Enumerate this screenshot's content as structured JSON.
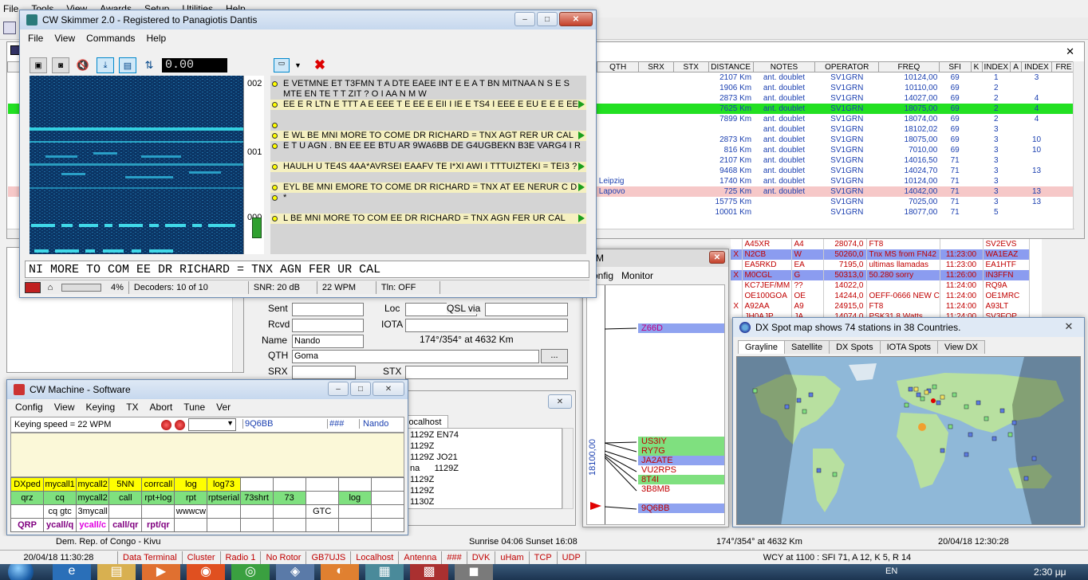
{
  "main_menu": [
    "File",
    "Tools",
    "View",
    "Awards",
    "Setup",
    "Utilities",
    "Help"
  ],
  "log": {
    "headers": [
      "QTH",
      "SRX",
      "STX",
      "DISTANCE",
      "NOTES",
      "OPERATOR",
      "FREQ",
      "SFI",
      "K",
      "INDEX",
      "A",
      "INDEX",
      "FRE"
    ],
    "rows": [
      {
        "qth": "",
        "distance": "2107 Km",
        "notes": "ant. doublet",
        "operator": "SV1GRN",
        "freq": "10124,00",
        "sfi": "69",
        "k": "1",
        "a": "3",
        "bg": ""
      },
      {
        "qth": "",
        "distance": "1906 Km",
        "notes": "ant. doublet",
        "operator": "SV1GRN",
        "freq": "10110,00",
        "sfi": "69",
        "k": "2",
        "a": "",
        "bg": ""
      },
      {
        "qth": "",
        "distance": "2873 Km",
        "notes": "ant. doublet",
        "operator": "SV1GRN",
        "freq": "14027,00",
        "sfi": "69",
        "k": "2",
        "a": "4",
        "bg": ""
      },
      {
        "qth": "",
        "distance": "7625 Km",
        "notes": "ant. doublet",
        "operator": "SV1GRN",
        "freq": "18075,00",
        "sfi": "69",
        "k": "2",
        "a": "4",
        "bg": "#22e022"
      },
      {
        "qth": "",
        "distance": "7899 Km",
        "notes": "ant. doublet",
        "operator": "SV1GRN",
        "freq": "18074,00",
        "sfi": "69",
        "k": "2",
        "a": "4",
        "bg": ""
      },
      {
        "qth": "",
        "distance": "",
        "notes": "ant. doublet",
        "operator": "SV1GRN",
        "freq": "18102,02",
        "sfi": "69",
        "k": "3",
        "a": "",
        "bg": ""
      },
      {
        "qth": "",
        "distance": "2873 Km",
        "notes": "ant. doublet",
        "operator": "SV1GRN",
        "freq": "18075,00",
        "sfi": "69",
        "k": "3",
        "a": "10",
        "bg": ""
      },
      {
        "qth": "",
        "distance": "816 Km",
        "notes": "ant. doublet",
        "operator": "SV1GRN",
        "freq": "7010,00",
        "sfi": "69",
        "k": "3",
        "a": "10",
        "bg": ""
      },
      {
        "qth": "",
        "distance": "2107 Km",
        "notes": "ant. doublet",
        "operator": "SV1GRN",
        "freq": "14016,50",
        "sfi": "71",
        "k": "3",
        "a": "",
        "bg": ""
      },
      {
        "qth": "",
        "distance": "9468 Km",
        "notes": "ant. doublet",
        "operator": "SV1GRN",
        "freq": "14024,70",
        "sfi": "71",
        "k": "3",
        "a": "13",
        "bg": ""
      },
      {
        "qth": "Leipzig",
        "distance": "1740 Km",
        "notes": "ant. doublet",
        "operator": "SV1GRN",
        "freq": "10124,00",
        "sfi": "71",
        "k": "3",
        "a": "",
        "bg": ""
      },
      {
        "qth": "Lapovo",
        "distance": "725 Km",
        "notes": "ant. doublet",
        "operator": "SV1GRN",
        "freq": "14042,00",
        "sfi": "71",
        "k": "3",
        "a": "13",
        "bg": "#f6c8c8"
      },
      {
        "qth": "",
        "distance": "15775 Km",
        "notes": "",
        "operator": "SV1GRN",
        "freq": "7025,00",
        "sfi": "71",
        "k": "3",
        "a": "13",
        "bg": ""
      },
      {
        "qth": "",
        "distance": "10001 Km",
        "notes": "",
        "operator": "SV1GRN",
        "freq": "18077,00",
        "sfi": "71",
        "k": "5",
        "a": "",
        "bg": ""
      }
    ]
  },
  "spots": [
    {
      "x": "",
      "call": "A45XR",
      "pfx": "A4",
      "freq": "28074,0",
      "comment": "FT8",
      "time": "",
      "spotter": "SV2EVS",
      "bg": "#fff"
    },
    {
      "x": "X",
      "call": "N2CB",
      "pfx": "W",
      "freq": "50260,0",
      "comment": "Tnx MS from FN42",
      "time": "11:23:00",
      "spotter": "WA1EAZ",
      "bg": "#8b9cf0"
    },
    {
      "x": "",
      "call": "EA5RKD",
      "pfx": "EA",
      "freq": "7195,0",
      "comment": "ultimas llamadas",
      "time": "11:23:00",
      "spotter": "EA1HTF",
      "bg": "#fff"
    },
    {
      "x": "X",
      "call": "M0CGL",
      "pfx": "G",
      "freq": "50313,0",
      "comment": "50.280 sorry",
      "time": "11:26:00",
      "spotter": "IN3FFN",
      "bg": "#8b9cf0"
    },
    {
      "x": "",
      "call": "KC7JEF/MM",
      "pfx": "??",
      "freq": "14022,0",
      "comment": "",
      "time": "11:24:00",
      "spotter": "RQ9A",
      "bg": "#fff"
    },
    {
      "x": "",
      "call": "OE100GOA",
      "pfx": "OE",
      "freq": "14244,0",
      "comment": "OEFF-0666 NEW C",
      "time": "11:24:00",
      "spotter": "OE1MRC",
      "bg": "#fff"
    },
    {
      "x": "X",
      "call": "A92AA",
      "pfx": "A9",
      "freq": "24915,0",
      "comment": "FT8",
      "time": "11:24:00",
      "spotter": "A93LT",
      "bg": "#fff"
    },
    {
      "x": "",
      "call": "JH0AJP",
      "pfx": "JA",
      "freq": "14074,0",
      "comment": "PSK31 8 Watts",
      "time": "11:24:00",
      "spotter": "SV3FOP",
      "bg": "#fff"
    }
  ],
  "skimmer": {
    "title": "CW Skimmer 2.0 - Registered to Panagiotis Dantis",
    "menu": [
      "File",
      "View",
      "Commands",
      "Help"
    ],
    "level": "0.00",
    "scale": [
      "002",
      "001",
      "000"
    ],
    "lines": [
      {
        "text": "E VETMNE ET T3FMN T A DTE EAEE INT E E A T BN MITNAA N S E S",
        "bg": "#d4d4d4",
        "marker": true
      },
      {
        "text": "MTE EN TE T T ZIT ? O I AA N M W",
        "bg": "#d4d4d4",
        "marker": false
      },
      {
        "text": "EE E R LTN E TTT A E EEE T E EE E EII I IE E TS4 I EEE E EU E E E EE",
        "bg": "#f5f0c0",
        "marker": true
      },
      {
        "text": "",
        "bg": "#d4d4d4",
        "marker": false
      },
      {
        "text": "",
        "bg": "#d4d4d4",
        "marker": true
      },
      {
        "text": "E WL BE MNI MORE TO COME DR RICHARD = TNX AGT RER UR CAL",
        "bg": "#f5f0c0",
        "marker": true
      },
      {
        "text": "E T U AGN . BN EE EE BTU AR 9WA6BB DE G4UGBEKN B3E VARG4 I R",
        "bg": "#d4d4d4",
        "marker": true
      },
      {
        "text": "",
        "bg": "#d4d4d4",
        "marker": false
      },
      {
        "text": "HAULH U TE4S 4AA*AVRSEI EAAFV TE I*XI AWI I TTTUIZTEKI = TEI3 ?",
        "bg": "#f5f0c0",
        "marker": true
      },
      {
        "text": "",
        "bg": "#d4d4d4",
        "marker": false
      },
      {
        "text": "EYL BE MNI EMORE TO COME DR RICHARD = TNX AT EE NERUR C D",
        "bg": "#f5f0c0",
        "marker": true
      },
      {
        "text": "*",
        "bg": "#d4d4d4",
        "marker": true
      },
      {
        "text": "",
        "bg": "#d4d4d4",
        "marker": false
      },
      {
        "text": "L BE MNI MORE TO COM EE DR RICHARD = TNX AGN FER UR CAL",
        "bg": "#f5f0c0",
        "marker": true
      }
    ],
    "decode": "NI MORE TO COM EE DR RICHARD = TNX AGN FER UR CAL",
    "status": {
      "pct": "4%",
      "decoders": "Decoders: 10 of 10",
      "snr": "SNR: 20 dB",
      "wpm": "22 WPM",
      "tln": "Tln: OFF"
    }
  },
  "qso_form": {
    "sent_label": "Sent",
    "loc_label": "Loc",
    "qsl_label": "QSL via",
    "rcvd_label": "Rcvd",
    "iota_label": "IOTA",
    "name_label": "Name",
    "name_value": "Nando",
    "bearing": "174°/354° at 4632 Km",
    "qth_label": "QTH",
    "qth_value": "Goma",
    "browse": "...",
    "srx_label": "SRX",
    "stx_label": "STX"
  },
  "terminal": {
    "tab": "localhost",
    "lines": [
      "1129Z EN74",
      "1129Z",
      "1129Z JO21",
      "na      1129Z",
      "1129Z",
      "1129Z",
      "1130Z"
    ]
  },
  "bandmap": {
    "title": "M",
    "menu": [
      "onfig",
      "Monitor"
    ],
    "freq_label": "18100,00",
    "calls": [
      {
        "call": "Z66D",
        "color": "#c00080",
        "bg": "#8fa3f0"
      },
      {
        "call": "US3IY",
        "color": "#c00000",
        "bg": "#7fe07f"
      },
      {
        "call": "RY7G",
        "color": "#c00000",
        "bg": "#7fe07f"
      },
      {
        "call": "JA2ATE",
        "color": "#c00000",
        "bg": "#8fa3f0"
      },
      {
        "call": "VU2RPS",
        "color": "#c00000",
        "bg": "#ffffff"
      },
      {
        "call": "8T4I",
        "color": "#c00000",
        "bg": "#7fe07f"
      },
      {
        "call": "3B8MB",
        "color": "#c00000",
        "bg": "#ffffff"
      },
      {
        "call": "9Q6BB",
        "color": "#c00000",
        "bg": "#8fa3f0"
      }
    ]
  },
  "dxmap": {
    "title": "DX Spot map shows 74 stations in 38 Countries.",
    "tabs": [
      "Grayline",
      "Satellite",
      "DX Spots",
      "IOTA Spots",
      "View DX"
    ]
  },
  "cwmachine": {
    "title": "CW Machine - Software",
    "menu": [
      "Config",
      "View",
      "Keying",
      "TX",
      "Abort",
      "Tune",
      "Ver"
    ],
    "keying": "Keying speed = 22 WPM",
    "call": "9Q6BB",
    "hash": "###",
    "name": "Nando",
    "macros": [
      [
        {
          "t": "DXped",
          "bg": "#ffff00",
          "c": "#000"
        },
        {
          "t": "mycall1",
          "bg": "#ffff00",
          "c": "#000"
        },
        {
          "t": "mycall2",
          "bg": "#ffff00",
          "c": "#000"
        },
        {
          "t": "5NN",
          "bg": "#ffff00",
          "c": "#000"
        },
        {
          "t": "corrcall",
          "bg": "#ffff00",
          "c": "#000"
        },
        {
          "t": "log",
          "bg": "#ffff00",
          "c": "#000"
        },
        {
          "t": "log73",
          "bg": "#ffff00",
          "c": "#000"
        },
        {
          "t": "",
          "bg": "#fff",
          "c": "#000"
        },
        {
          "t": "",
          "bg": "#fff",
          "c": "#000"
        },
        {
          "t": "",
          "bg": "#fff",
          "c": "#000"
        },
        {
          "t": "",
          "bg": "#fff",
          "c": "#000"
        },
        {
          "t": "",
          "bg": "#fff",
          "c": "#000"
        }
      ],
      [
        {
          "t": "qrz",
          "bg": "#7fe07f",
          "c": "#000"
        },
        {
          "t": "cq",
          "bg": "#7fe07f",
          "c": "#000"
        },
        {
          "t": "mycall2",
          "bg": "#7fe07f",
          "c": "#000"
        },
        {
          "t": "call",
          "bg": "#7fe07f",
          "c": "#000"
        },
        {
          "t": "rpt+log",
          "bg": "#7fe07f",
          "c": "#000"
        },
        {
          "t": "rpt",
          "bg": "#7fe07f",
          "c": "#000"
        },
        {
          "t": "rptserial",
          "bg": "#7fe07f",
          "c": "#000"
        },
        {
          "t": "73shrt",
          "bg": "#7fe07f",
          "c": "#000"
        },
        {
          "t": "73",
          "bg": "#7fe07f",
          "c": "#000"
        },
        {
          "t": "",
          "bg": "#fff",
          "c": "#000"
        },
        {
          "t": "log",
          "bg": "#7fe07f",
          "c": "#000"
        },
        {
          "t": "",
          "bg": "#fff",
          "c": "#000"
        }
      ],
      [
        {
          "t": "",
          "bg": "#fff",
          "c": "#000"
        },
        {
          "t": "cq gtc",
          "bg": "#fff",
          "c": "#000"
        },
        {
          "t": "3mycall",
          "bg": "#fff",
          "c": "#000"
        },
        {
          "t": "",
          "bg": "#fff",
          "c": "#000"
        },
        {
          "t": "",
          "bg": "#fff",
          "c": "#000"
        },
        {
          "t": "wwwcw",
          "bg": "#fff",
          "c": "#000"
        },
        {
          "t": "",
          "bg": "#fff",
          "c": "#000"
        },
        {
          "t": "",
          "bg": "#fff",
          "c": "#000"
        },
        {
          "t": "",
          "bg": "#fff",
          "c": "#000"
        },
        {
          "t": "GTC",
          "bg": "#fff",
          "c": "#000"
        },
        {
          "t": "",
          "bg": "#fff",
          "c": "#000"
        },
        {
          "t": "",
          "bg": "#fff",
          "c": "#000"
        }
      ],
      [
        {
          "t": "QRP",
          "bg": "#fff",
          "c": "#800080"
        },
        {
          "t": "ycall/q",
          "bg": "#fff",
          "c": "#800080"
        },
        {
          "t": "ycall/c",
          "bg": "#fff",
          "c": "#e000e0"
        },
        {
          "t": "call/qr",
          "bg": "#fff",
          "c": "#800080"
        },
        {
          "t": "rpt/qr",
          "bg": "#fff",
          "c": "#800080"
        },
        {
          "t": "",
          "bg": "#fff",
          "c": "#000"
        },
        {
          "t": "",
          "bg": "#fff",
          "c": "#000"
        },
        {
          "t": "",
          "bg": "#fff",
          "c": "#000"
        },
        {
          "t": "",
          "bg": "#fff",
          "c": "#000"
        },
        {
          "t": "",
          "bg": "#fff",
          "c": "#000"
        },
        {
          "t": "",
          "bg": "#fff",
          "c": "#000"
        },
        {
          "t": "",
          "bg": "#fff",
          "c": "#000"
        }
      ]
    ]
  },
  "info_bar": {
    "country": "Dem. Rep. of Congo - Kivu",
    "sun": "Sunrise 04:06 Sunset 16:08",
    "bearing": "174°/354° at 4632 Km",
    "local_time": "20/04/18 12:30:28"
  },
  "status_bar": {
    "utc": "20/04/18 11:30:28",
    "items": [
      "Data Terminal",
      "Cluster",
      "Radio 1",
      "No Rotor",
      "GB7UJS",
      "Localhost",
      "Antenna",
      "###",
      "DVK",
      "uHam",
      "TCP",
      "UDP"
    ],
    "wcy": "WCY at 1100 : SFI 71, A 12, K 5, R 14"
  },
  "taskbar": {
    "lang": "EN",
    "time": "2:30 μμ"
  }
}
